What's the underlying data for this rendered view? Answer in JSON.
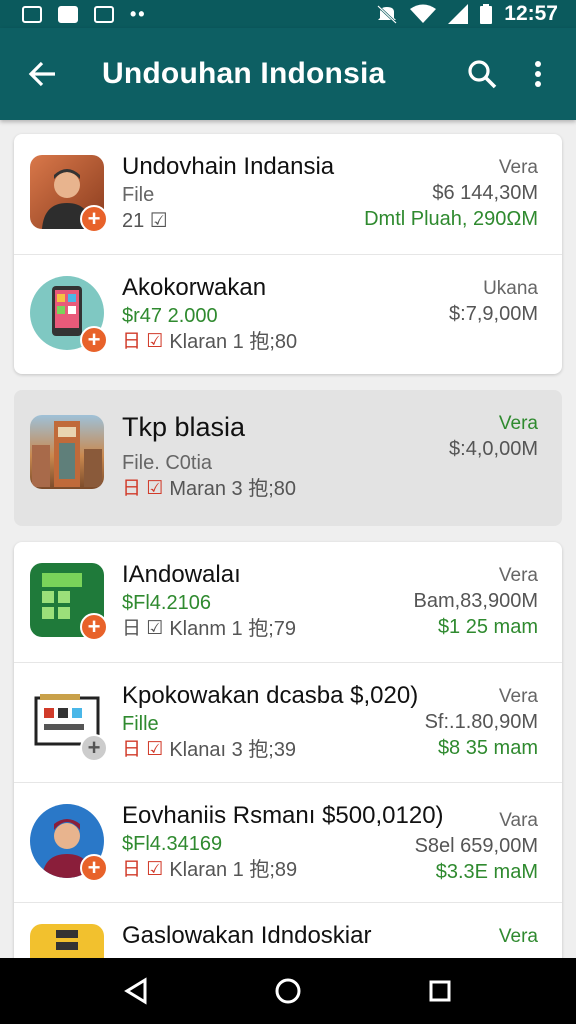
{
  "status_bar": {
    "time": "12:57"
  },
  "app_bar": {
    "title": "Undouhan Indonsia"
  },
  "rows": [
    {
      "name": "Undovhain Indansia",
      "sub": "File",
      "meta": "21 ☑",
      "right_top": "Vera",
      "right_mid": "$6 144,30M",
      "right_bottom": "Dmtl Pluah, 290ΩM"
    },
    {
      "name": "Akokorwakan",
      "sub": "$r47 2.000",
      "meta_flag": "日 ☑",
      "meta": "Klaran 1 抱;80",
      "right_top": "Ukana",
      "right_mid": "$:7,9,00M"
    },
    {
      "name": "Tkp blasia",
      "sub": "File. C0tia",
      "meta_flag": "日 ☑",
      "meta": "Maran 3 抱;80",
      "right_top": "Vera",
      "right_mid": "$:4,0,00M"
    },
    {
      "name": "IAndowalaı",
      "sub": "$Fl4.2106",
      "meta_flag": "日 ☑",
      "meta": "Klanm 1 抱;79",
      "right_top": "Vera",
      "right_mid": "Bam,83,900M",
      "right_bottom": "$1 25 mam"
    },
    {
      "name": "Kpokowakan dcasba $,020)",
      "sub": "Fille",
      "meta_flag": "日 ☑",
      "meta": "Klanaı 3 抱;39",
      "right_top": "Vera",
      "right_mid": "Sf:.1.80,90M",
      "right_bottom": "$8 35 mam"
    },
    {
      "name": "Eovhaniis Rsmanı $500,0120)",
      "sub": "$Fl4.34169",
      "meta_flag": "日 ☑",
      "meta": "Klaran 1 抱;89",
      "right_top": "Vara",
      "right_mid": "S8el 659,00M",
      "right_bottom": "$3.3E maM"
    },
    {
      "name": "Gaslowakan Idndoskiar",
      "right_top": "Vera"
    }
  ],
  "colors": {
    "primary": "#0d5f63",
    "accent": "#e8622a",
    "green": "#2f8a2f",
    "red": "#d13b2a"
  },
  "icons": [
    "back-arrow-icon",
    "search-icon",
    "more-vert-icon",
    "nav-back-icon",
    "nav-home-icon",
    "nav-recents-icon"
  ]
}
